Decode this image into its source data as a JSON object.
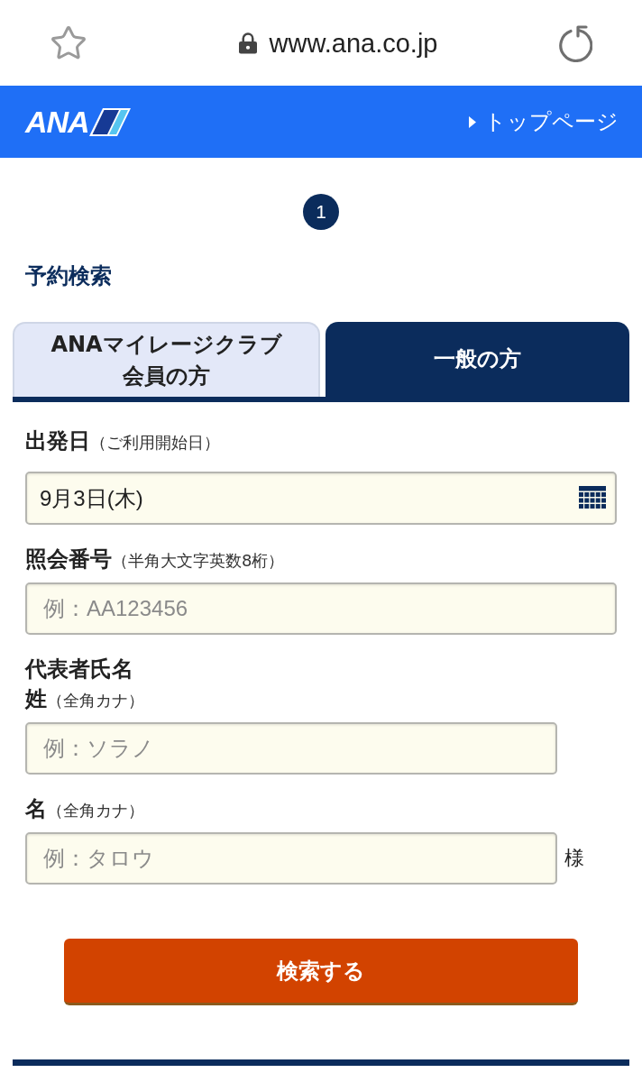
{
  "browser_bar": {
    "url": "www.ana.co.jp"
  },
  "header": {
    "logo": "ANA",
    "top_link": "トップページ"
  },
  "step": "1",
  "title": "予約検索",
  "tabs": [
    {
      "lines": [
        "ANAマイレージクラブ",
        "会員の方"
      ],
      "selected": false
    },
    {
      "lines": [
        "一般の方"
      ],
      "selected": true
    }
  ],
  "form": {
    "departure": {
      "label": "出発日",
      "note": "（ご利用開始日）",
      "value": "9月3日(木)"
    },
    "reference": {
      "label": "照会番号",
      "note": "（半角大文字英数8桁）",
      "placeholder": "例：AA123456"
    },
    "name": {
      "heading": "代表者氏名",
      "fields": [
        {
          "label": "姓",
          "note": "（全角カナ）",
          "placeholder": "例：ソラノ"
        },
        {
          "label": "名",
          "note": "（全角カナ）",
          "placeholder": "例：タロウ",
          "suffix": "様"
        }
      ]
    }
  },
  "search_button": "検索する"
}
